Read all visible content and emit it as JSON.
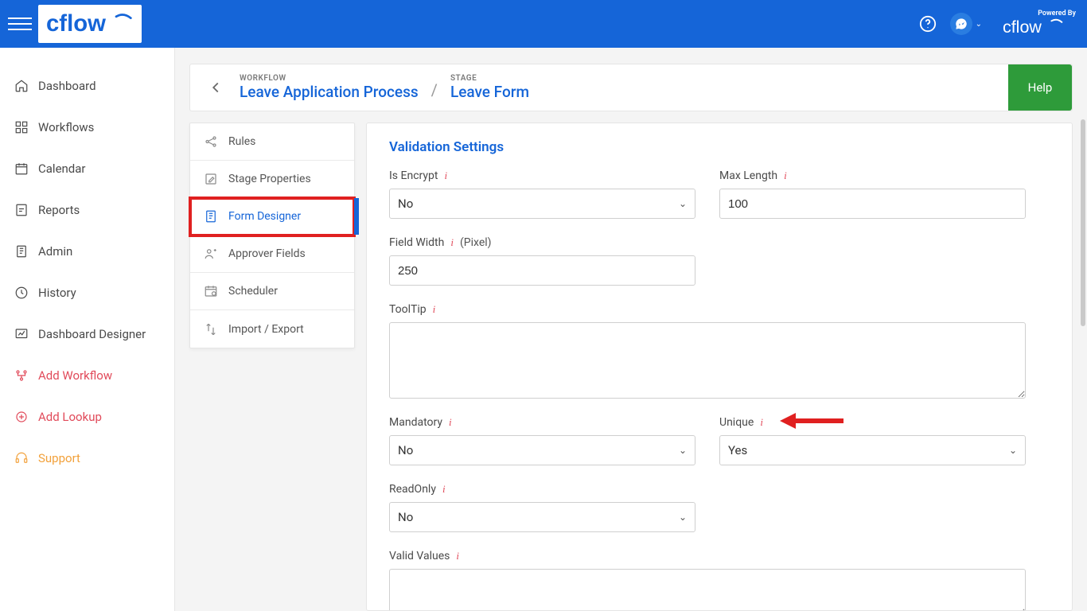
{
  "brand": {
    "powered_by": "Powered By"
  },
  "main_nav": [
    {
      "label": "Dashboard",
      "accent": false,
      "support": false
    },
    {
      "label": "Workflows",
      "accent": false,
      "support": false
    },
    {
      "label": "Calendar",
      "accent": false,
      "support": false
    },
    {
      "label": "Reports",
      "accent": false,
      "support": false
    },
    {
      "label": "Admin",
      "accent": false,
      "support": false
    },
    {
      "label": "History",
      "accent": false,
      "support": false
    },
    {
      "label": "Dashboard Designer",
      "accent": false,
      "support": false
    },
    {
      "label": "Add Workflow",
      "accent": true,
      "support": false
    },
    {
      "label": "Add Lookup",
      "accent": true,
      "support": false
    },
    {
      "label": "Support",
      "accent": false,
      "support": true
    }
  ],
  "breadcrumb": {
    "workflow_eyebrow": "WORKFLOW",
    "workflow_name": "Leave Application Process",
    "stage_eyebrow": "STAGE",
    "stage_name": "Leave Form"
  },
  "buttons": {
    "help": "Help"
  },
  "config_nav": [
    {
      "label": "Rules",
      "active": false
    },
    {
      "label": "Stage Properties",
      "active": false
    },
    {
      "label": "Form Designer",
      "active": true
    },
    {
      "label": "Approver Fields",
      "active": false
    },
    {
      "label": "Scheduler",
      "active": false
    },
    {
      "label": "Import / Export",
      "active": false
    }
  ],
  "section_title": "Validation Settings",
  "fields": {
    "is_encrypt": {
      "label": "Is Encrypt",
      "value": "No"
    },
    "max_length": {
      "label": "Max Length",
      "value": "100"
    },
    "field_width": {
      "label": "Field Width",
      "suffix": "(Pixel)",
      "value": "250"
    },
    "tooltip": {
      "label": "ToolTip",
      "value": ""
    },
    "mandatory": {
      "label": "Mandatory",
      "value": "No"
    },
    "unique": {
      "label": "Unique",
      "value": "Yes"
    },
    "readonly": {
      "label": "ReadOnly",
      "value": "No"
    },
    "valid_values": {
      "label": "Valid Values",
      "value": ""
    }
  }
}
